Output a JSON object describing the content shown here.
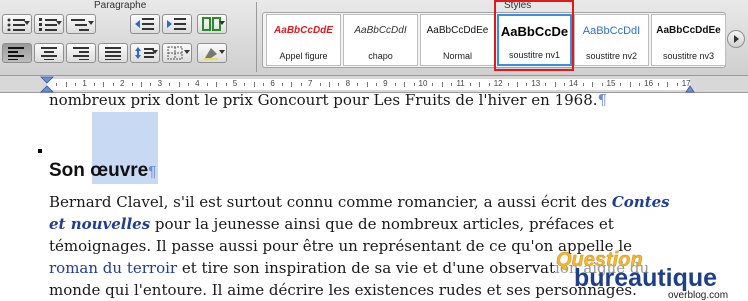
{
  "ribbon": {
    "paragraph_title": "Paragraphe",
    "styles_title": "Styles",
    "styles": [
      {
        "sample": "AaBbCcDdE",
        "name": "Appel figure",
        "color": "#e0191d"
      },
      {
        "sample": "AaBbCcDdI",
        "name": "chapo",
        "color": "#333333"
      },
      {
        "sample": "AaBbCcDdEe",
        "name": "Normal",
        "color": "#111111"
      },
      {
        "sample": "AaBbCcDe",
        "name": "soustitre nv1",
        "color": "#000000"
      },
      {
        "sample": "AaBbCcDdI",
        "name": "soustitre nv2",
        "color": "#2f6fd0"
      },
      {
        "sample": "AaBbCcDdEe",
        "name": "soustitre nv3",
        "color": "#111111"
      }
    ]
  },
  "ruler": {
    "numbers": [
      "1",
      "2",
      "3",
      "4",
      "5",
      "6",
      "7",
      "8",
      "9",
      "10",
      "11",
      "12",
      "13",
      "14",
      "15",
      "16",
      "17"
    ]
  },
  "document": {
    "line_top": {
      "text": "nombreux prix dont le prix Goncourt pour Les Fruits de l'hiver en 1968.",
      "pilcrow": "¶"
    },
    "heading": {
      "text": "Son œuvre",
      "pilcrow": "¶"
    },
    "p1": {
      "l1_a": "Bernard Clavel, s'il est surtout connu comme romancier, a aussi écrit des ",
      "l1_b": "Contes",
      "l2_a": "et nouvelles",
      "l2_b": " pour la jeunesse ainsi que de nombreux articles, préfaces et",
      "l3": "témoignages. Il passe aussi pour être un représentant de ce qu'on appelle le",
      "l4_a": "roman du terroir",
      "l4_b": " et tire son inspiration de sa vie et d'une observation aiguë du",
      "l5": "monde qui l'entoure. Il aime décrire les existences rudes et ses personnages."
    }
  },
  "logo": {
    "line1": "Question",
    "line2": "bureautique",
    "line3": "overblog.com"
  }
}
